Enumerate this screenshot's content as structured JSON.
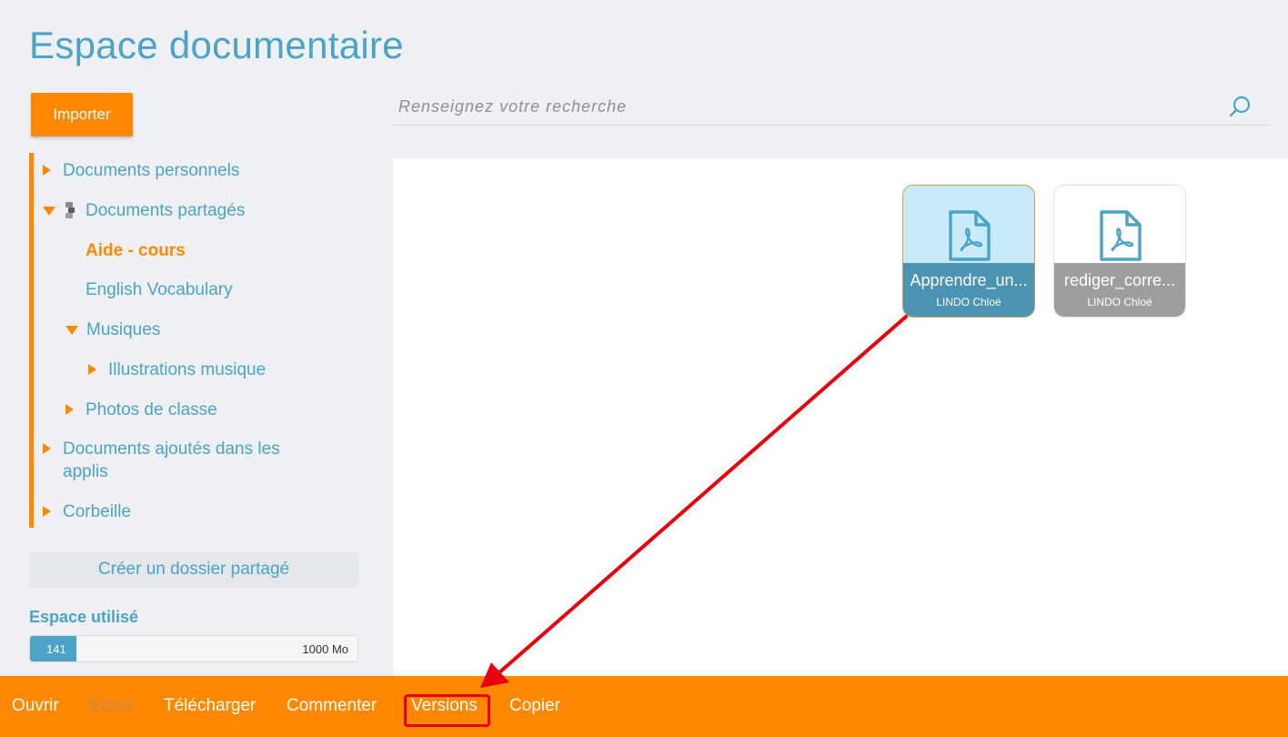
{
  "header": {
    "title": "Espace documentaire"
  },
  "sidebar": {
    "import_label": "Importer",
    "tree": {
      "personal": "Documents personnels",
      "shared": "Documents partagés",
      "aide": "Aide - cours",
      "english": "English Vocabulary",
      "musiques": "Musiques",
      "illustrations": "Illustrations musique",
      "photos": "Photos de classe",
      "apps": "Documents ajoutés dans les applis",
      "trash": "Corbeille"
    },
    "create_shared_folder": "Créer un dossier partagé",
    "space": {
      "title": "Espace utilisé",
      "used": "141",
      "total": "1000 Mo",
      "fraction": 0.141
    }
  },
  "search": {
    "placeholder": "Renseignez votre recherche"
  },
  "files": [
    {
      "name": "Apprendre_un...",
      "owner": "LINDO Chloé",
      "selected": true
    },
    {
      "name": "rediger_corre...",
      "owner": "LINDO Chloé",
      "selected": false
    }
  ],
  "toolbar": {
    "open": "Ouvrir",
    "edit": "Éditer",
    "download": "Télécharger",
    "comment": "Commenter",
    "versions": "Versions",
    "copy": "Copier"
  },
  "colors": {
    "accent": "#ff8800",
    "primary": "#4ba3c7",
    "annotation": "#e8000b"
  }
}
